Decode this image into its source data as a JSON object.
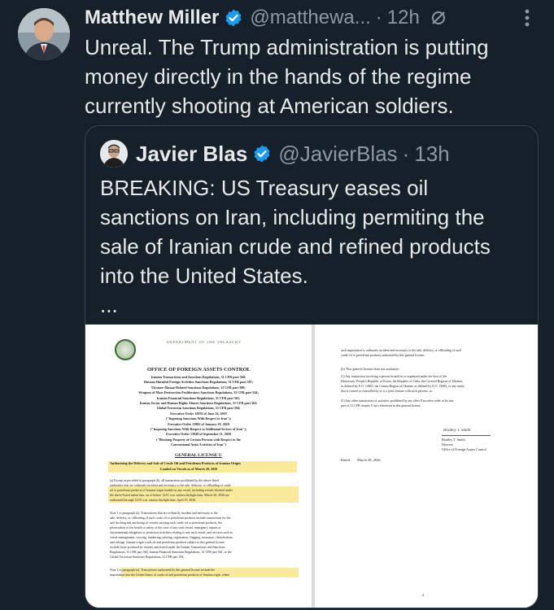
{
  "tweet": {
    "author_name": "Matthew Miller",
    "author_handle": "@matthewa...",
    "separator": "·",
    "time": "12h",
    "text": "Unreal. The Trump administration is putting money directly in the hands of the regime currently shooting at American soldiers."
  },
  "quote": {
    "author_name": "Javier Blas",
    "author_handle": "@JavierBlas",
    "separator": "·",
    "time": "13h",
    "text": "BREAKING: US Treasury eases oil sanctions on Iran, including permiting the sale of Iranian crude and refined products into the United States.",
    "more": "..."
  },
  "document": {
    "left": {
      "dept": "DEPARTMENT OF THE TREASURY",
      "office": "OFFICE OF FOREIGN ASSETS CONTROL",
      "regs": [
        "Iranian Transactions and Sanctions Regulations, 31 CFR part 560;",
        "Russian Harmful Foreign Activities Sanctions Regulations, 31 CFR part 587;",
        "Ukraine-/Russia-Related Sanctions Regulations, 31 CFR part 589;",
        "Weapons of Mass Destruction Proliferators Sanctions Regulations, 31 CFR part 544;",
        "Iranian Financial Sanctions Regulations, 31 CFR part 561;",
        "Iranian Sector and Human Rights Abuses Sanctions Regulations, 31 CFR part 562;",
        "Global Terrorism Sanctions Regulations, 31 CFR part 594;",
        "Executive Order 13876 of June 24, 2019",
        "(\"Imposing Sanctions With Respect to Iran\");",
        "Executive Order 13902 of January 10, 2020",
        "(\"Imposing Sanctions With Respect to Additional Sectors of Iran\");",
        "Executive Order 13949 of September 21, 2020",
        "(\"Blocking Property of Certain Persons with Respect to the",
        "Conventional Arms Activities of Iran\")"
      ],
      "license": "GENERAL LICENSE U",
      "license_title_1": "Authorizing the Delivery and Sale of Crude Oil and Petroleum Products of Iranian Origin",
      "license_title_2": "Loaded on Vessels as of March 20, 2026",
      "para_a": [
        "(a) Except as provided in paragraph (b), all transactions prohibited by the above-listed",
        "authorities that are ordinarily incident and necessary to the sale, delivery, or offloading of crude",
        "oil or petroleum products of Iranian origin loaded on any vessel, including vessels blocked under",
        "the above-listed authorities, on or before 12:01 a.m. eastern daylight time, March 20, 2026 are",
        "authorized through 12:01 a.m. eastern daylight time, April 19, 2026."
      ],
      "note1": [
        "Note 1 to paragraph (a). Transactions that are ordinarily incident and necessary to the",
        "sale, delivery, or offloading of such crude oil or petroleum products include transactions for the",
        "safe docking and anchoring of vessels carrying such crude oil or petroleum products, the",
        "preservation of the health or safety of the crew of any such vessel, emergency repairs or",
        "environmental mitigation or protection activities relating to any such vessel, and services such as",
        "vessel management, crewing, bunkering, piloting, registration, flagging, insurance, classification,",
        "and salvage. Iranian-origin crude oil and petroleum products subject to this general license",
        "include those produced by entities sanctioned under the Iranian Transactions and Sanctions",
        "Regulations, 31 CFR part 560, Iranian Financial Sanctions Regulations, 31 CFR part 561, or the",
        "Global Terrorism Sanctions Regulations, 31 CFR part 594."
      ],
      "note2": [
        "Note 2 to paragraph (a). Transactions authorized by this general license include the",
        "importation into the United States of crude oil and petroleum products of Iranian origin, where"
      ]
    },
    "right": {
      "lines_top": [
        "such importation is ordinarily incident and necessary to the sale, delivery, or offloading of such",
        "crude oil or petroleum products authorized by this general license."
      ],
      "para_b_head": "(b) This general license does not authorize:",
      "para_b1": [
        "(1) Any transaction involving a person located in or organized under the laws of the",
        "Democratic People's Republic of Korea, the Republic of Cuba, the Covered Regions of Ukraine,",
        "as defined by E.O. 14065, the Crimea Region of Ukraine, as defined by E.O. 13685, or any entity",
        "that is owned or controlled by or is a joint venture with such persons; or"
      ],
      "para_b2": [
        "(2) Any other transactions or activities prohibited by any other Executive order or by any",
        "part of 31 CFR chapter V not referenced in this general license."
      ],
      "sig_name": "Bradley T. Smith",
      "sig_title_1": "Director",
      "sig_title_2": "Office of Foreign Assets Control",
      "dated_label": "Dated:",
      "dated_value": "March 20, 2026",
      "page_num": "2"
    }
  },
  "colors": {
    "background": "#15202b",
    "text": "#e7e9ea",
    "muted": "#8b98a5",
    "verified": "#1d9bf0",
    "border": "#38444d",
    "highlight": "#f7e37a"
  },
  "icons": [
    "verified-badge-icon",
    "edited-icon",
    "more-options-icon"
  ]
}
